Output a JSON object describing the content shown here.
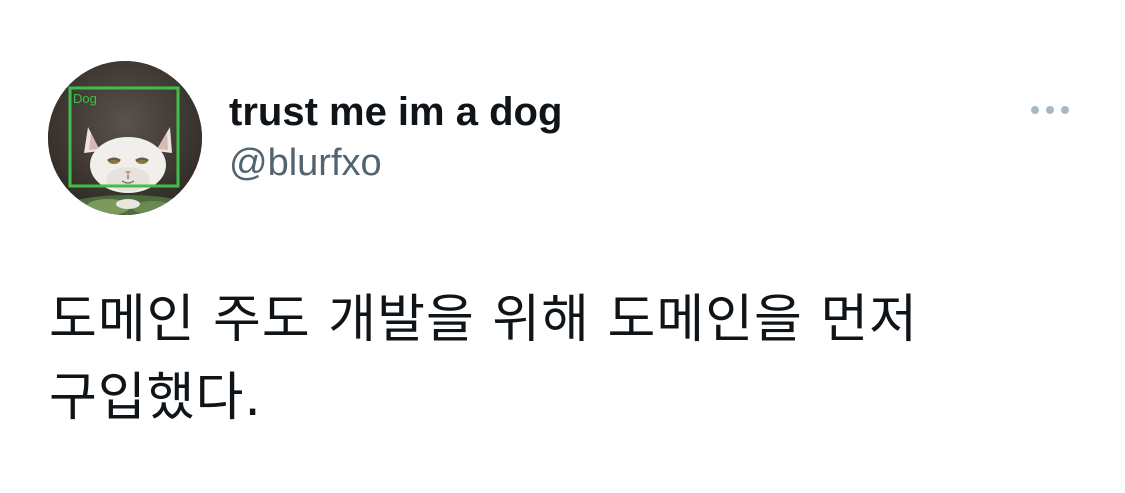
{
  "tweet": {
    "author": {
      "display_name": "trust me im a dog",
      "handle": "@blurfxo",
      "avatar": {
        "detection_label": "Dog",
        "detection_box_color": "#3fbf4a"
      }
    },
    "more_icon": "ellipsis-horizontal-icon",
    "text": "도메인 주도 개발을 위해 도메인을 먼저 구입했다."
  },
  "colors": {
    "text_primary": "#0f1419",
    "text_secondary": "#536471",
    "icon_muted": "#aab8c2",
    "background": "#ffffff"
  }
}
